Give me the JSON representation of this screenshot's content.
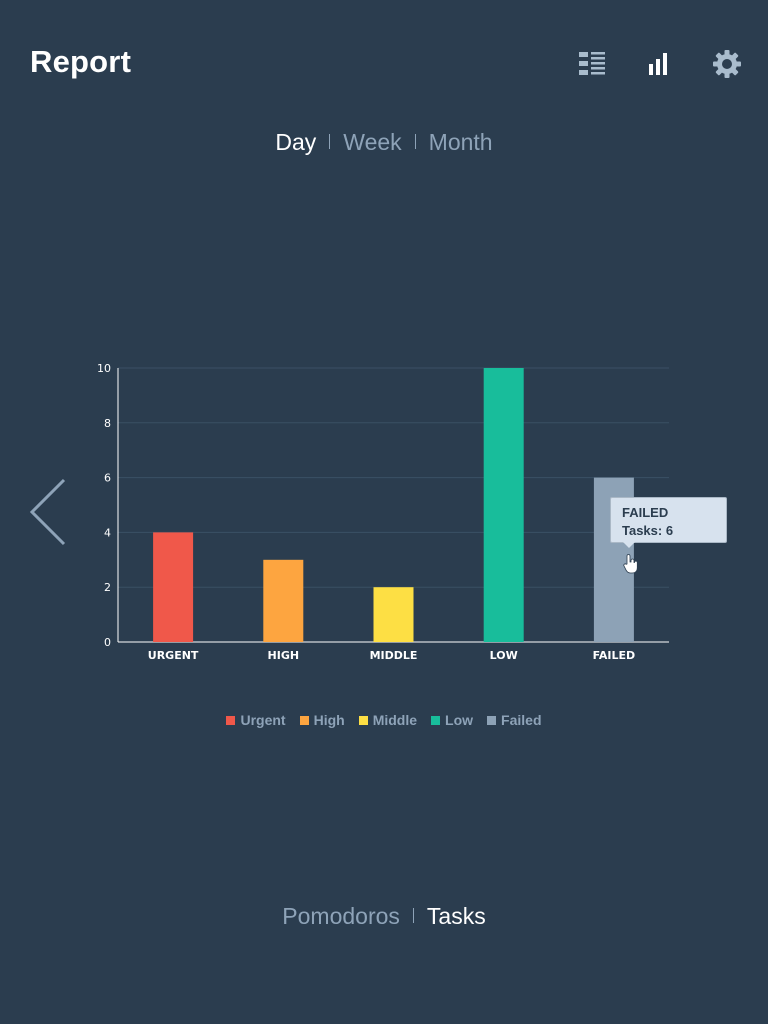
{
  "header": {
    "title": "Report",
    "icons": [
      "list-view-icon",
      "bar-chart-icon",
      "gear-icon"
    ]
  },
  "period_tabs": [
    {
      "label": "Day",
      "active": true
    },
    {
      "label": "Week",
      "active": false
    },
    {
      "label": "Month",
      "active": false
    }
  ],
  "mode_tabs": [
    {
      "label": "Pomodoros",
      "active": false
    },
    {
      "label": "Tasks",
      "active": true
    }
  ],
  "chart_data": {
    "type": "bar",
    "categories": [
      "URGENT",
      "HIGH",
      "MIDDLE",
      "LOW",
      "FAILED"
    ],
    "values": [
      4,
      3,
      2,
      10,
      6
    ],
    "colors": [
      "#f0584a",
      "#fda540",
      "#fddf44",
      "#18bd9b",
      "#8da2b6"
    ],
    "ylim": [
      0,
      10
    ],
    "yticks": [
      0,
      2,
      4,
      6,
      8,
      10
    ],
    "grid": true,
    "legend": [
      "Urgent",
      "High",
      "Middle",
      "Low",
      "Failed"
    ],
    "legend_position": "bottom"
  },
  "tooltip": {
    "title": "FAILED",
    "text": "Tasks: 6"
  },
  "colors": {
    "background": "#2b3d4f",
    "muted_text": "#8ea3b8",
    "active_text": "#ffffff"
  }
}
